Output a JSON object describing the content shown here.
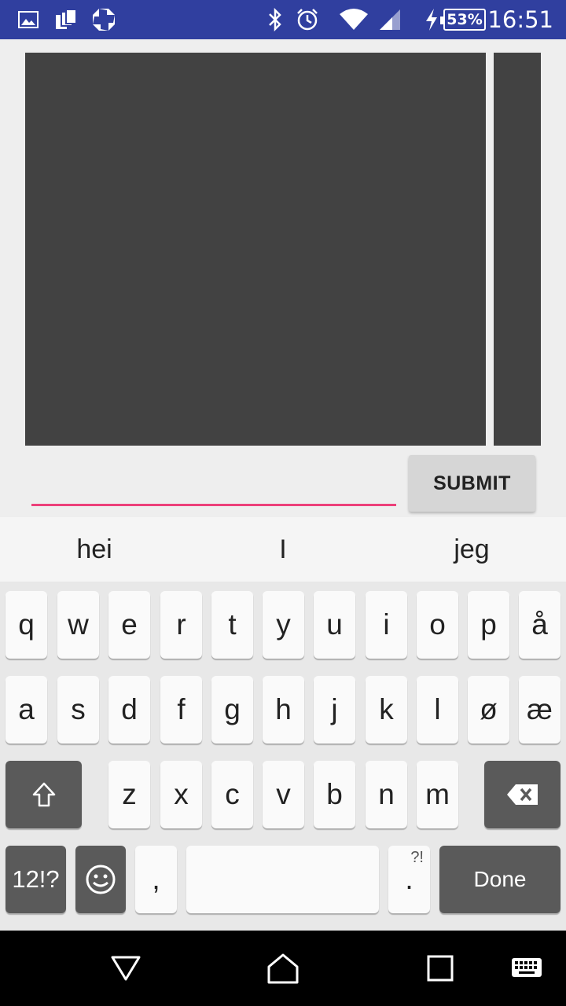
{
  "status_bar": {
    "icons": [
      "gallery-icon",
      "stack-icon",
      "chase-logo-icon",
      "bluetooth-icon",
      "alarm-icon",
      "wifi-icon",
      "signal-icon",
      "charging-icon",
      "battery-icon"
    ],
    "battery": "53%",
    "time": "16:51"
  },
  "form": {
    "input_value": "",
    "submit_label": "SUBMIT",
    "accent_color": "#ec407a"
  },
  "keyboard": {
    "suggestions": [
      "hei",
      "I",
      "jeg"
    ],
    "row1": [
      "q",
      "w",
      "e",
      "r",
      "t",
      "y",
      "u",
      "i",
      "o",
      "p",
      "å"
    ],
    "row2": [
      "a",
      "s",
      "d",
      "f",
      "g",
      "h",
      "j",
      "k",
      "l",
      "ø",
      "æ"
    ],
    "row3": [
      "z",
      "x",
      "c",
      "v",
      "b",
      "n",
      "m"
    ],
    "symbols_label": "12!?",
    "comma": ",",
    "period": ".",
    "period_hint": "?!",
    "done_label": "Done"
  },
  "nav_bar": {
    "icons": [
      "back-icon",
      "home-icon",
      "recents-icon",
      "keyboard-icon"
    ]
  }
}
